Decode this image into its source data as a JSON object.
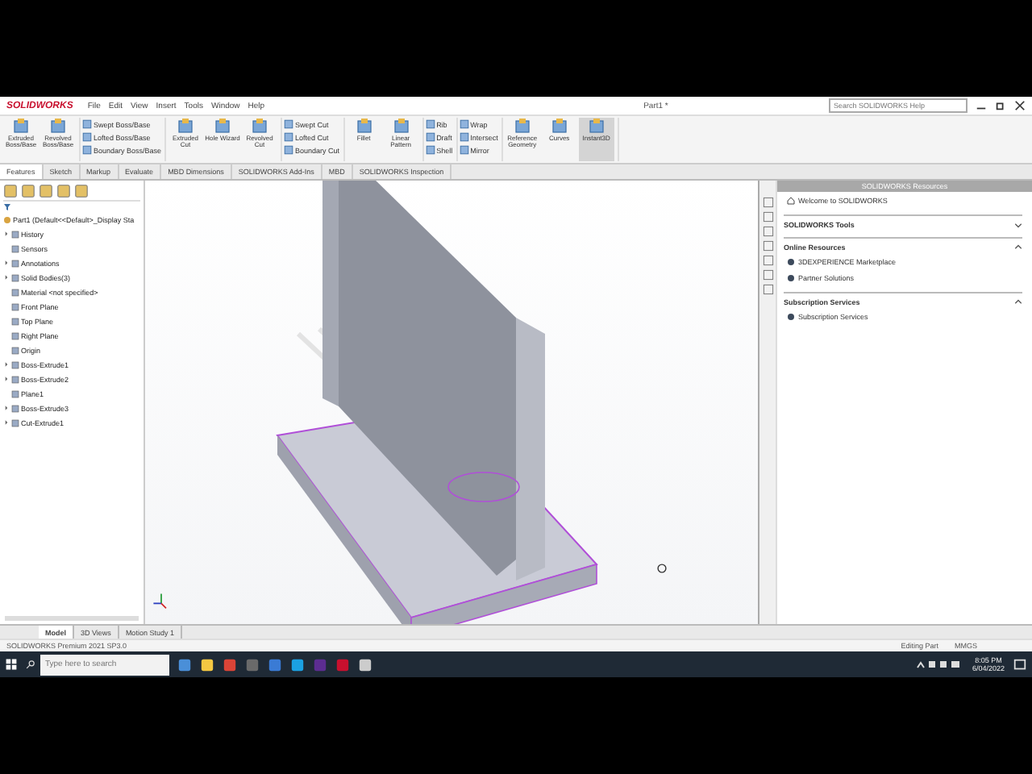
{
  "title_bar": {
    "logo": "SOLIDWORKS",
    "menus": [
      "File",
      "Edit",
      "View",
      "Insert",
      "Tools",
      "Window",
      "Help"
    ],
    "document_title": "Part1 *",
    "search": {
      "placeholder": "Search SOLIDWORKS Help"
    }
  },
  "ribbon": [
    {
      "kind": "large",
      "items": [
        "Extruded Boss/Base",
        "Revolved Boss/Base"
      ]
    },
    {
      "kind": "stack",
      "items": [
        "Swept Boss/Base",
        "Lofted Boss/Base",
        "Boundary Boss/Base"
      ]
    },
    {
      "kind": "large",
      "items": [
        "Extruded Cut",
        "Hole Wizard",
        "Revolved Cut"
      ]
    },
    {
      "kind": "stack",
      "items": [
        "Swept Cut",
        "Lofted Cut",
        "Boundary Cut"
      ]
    },
    {
      "kind": "large",
      "items": [
        "Fillet",
        "Linear Pattern"
      ]
    },
    {
      "kind": "stack",
      "items": [
        "Rib",
        "Draft",
        "Shell"
      ]
    },
    {
      "kind": "stack",
      "items": [
        "Wrap",
        "Intersect",
        "Mirror"
      ]
    },
    {
      "kind": "large",
      "items": [
        "Reference Geometry",
        "Curves",
        "Instant3D"
      ]
    }
  ],
  "command_tabs": [
    {
      "label": "Features",
      "selected": true
    },
    {
      "label": "Sketch",
      "selected": false
    },
    {
      "label": "Markup",
      "selected": false
    },
    {
      "label": "Evaluate",
      "selected": false
    },
    {
      "label": "MBD Dimensions",
      "selected": false
    },
    {
      "label": "SOLIDWORKS Add-Ins",
      "selected": false
    },
    {
      "label": "MBD",
      "selected": false
    },
    {
      "label": "SOLIDWORKS Inspection",
      "selected": false
    }
  ],
  "feature_tree": {
    "root": "Part1 (Default<<Default>_Display Sta",
    "items": [
      {
        "label": "History",
        "expandable": true
      },
      {
        "label": "Sensors",
        "expandable": false
      },
      {
        "label": "Annotations",
        "expandable": true
      },
      {
        "label": "Solid Bodies(3)",
        "expandable": true
      },
      {
        "label": "Material <not specified>",
        "expandable": false
      },
      {
        "label": "Front Plane",
        "expandable": false
      },
      {
        "label": "Top Plane",
        "expandable": false
      },
      {
        "label": "Right Plane",
        "expandable": false
      },
      {
        "label": "Origin",
        "expandable": false
      },
      {
        "label": "Boss-Extrude1",
        "expandable": true
      },
      {
        "label": "Boss-Extrude2",
        "expandable": true
      },
      {
        "label": "Plane1",
        "expandable": false
      },
      {
        "label": "Boss-Extrude3",
        "expandable": true
      },
      {
        "label": "Cut-Extrude1",
        "expandable": true
      }
    ]
  },
  "task_pane": {
    "title": "SOLIDWORKS Resources",
    "welcome": "Welcome to SOLIDWORKS",
    "sections": [
      {
        "title": "SOLIDWORKS Tools",
        "expanded": false
      },
      {
        "title": "Online Resources",
        "expanded": true,
        "items": [
          "3DEXPERIENCE Marketplace",
          "Partner Solutions"
        ]
      },
      {
        "title": "Subscription Services",
        "expanded": true,
        "items": [
          "Subscription Services"
        ]
      }
    ]
  },
  "bottom_tabs": [
    {
      "label": "Model",
      "selected": true
    },
    {
      "label": "3D Views",
      "selected": false
    },
    {
      "label": "Motion Study 1",
      "selected": false
    }
  ],
  "status_bar": {
    "product": "SOLIDWORKS Premium 2021 SP3.0",
    "mode": "Editing Part",
    "units": "MMGS"
  },
  "taskbar": {
    "search": {
      "placeholder": "Type here to search"
    },
    "time": "8:05 PM",
    "date": "6/04/2022"
  }
}
